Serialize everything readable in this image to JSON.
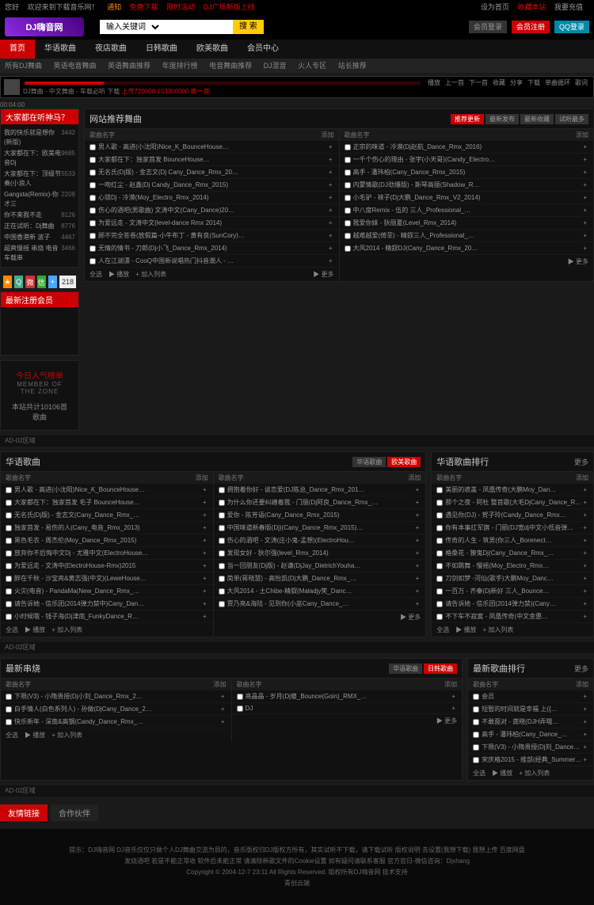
{
  "topbar": {
    "left": [
      "您好",
      "欢迎来到下载音乐网！",
      "通知",
      "免费下载",
      "限时活动",
      "DJ广场新版上线"
    ],
    "right": [
      "设为首页",
      "收藏本站",
      "我要充值"
    ]
  },
  "logo": "DJ嗨音网",
  "search": {
    "select": "输入关键词",
    "placeholder": "",
    "btn": "搜 索"
  },
  "header_btns": {
    "login": "会员登录",
    "reg": "会员注册",
    "qq": "QQ登录"
  },
  "nav": [
    "首页",
    "华语歌曲",
    "夜店歌曲",
    "日韩歌曲",
    "欧美歌曲",
    "会员中心"
  ],
  "subnav": [
    "所有DJ舞曲",
    "英语电音舞曲",
    "英语舞曲推荐",
    "年度排行榜",
    "电音舞曲推荐",
    "DJ混音",
    "火人专区",
    "站长推荐"
  ],
  "player": {
    "time": "00:04:00",
    "text": "DJ舞曲 - 中文舞曲 - 车载必听 下载",
    "text2": "上传720000 153300000 换一首",
    "btns": [
      "播放",
      "上一首",
      "下一首",
      "收藏",
      "分享",
      "下载",
      "单曲循环",
      "歌词"
    ]
  },
  "hot": {
    "title": "大家都在听神马？",
    "items": [
      {
        "n": "我的快乐就是想你(新版)",
        "c": "3442"
      },
      {
        "n": "大家都在下：欧美电音Dj",
        "c": "9685"
      },
      {
        "n": "大家都在下：顶级节奏(小浪人",
        "c": "5533"
      },
      {
        "n": "Gangsta(Remix)-你才三",
        "c": "2208"
      },
      {
        "n": "你不来我不走",
        "c": "8126"
      },
      {
        "n": "正在试听：Dj舞曲",
        "c": "8776"
      },
      {
        "n": "中国香港新 波子",
        "c": "4467"
      },
      {
        "n": "超爽慢摇 串烧 电音车载串",
        "c": "3466"
      }
    ]
  },
  "member_title": "最新注册会员",
  "share_count": "218",
  "zone": {
    "title": "今日人气榜单",
    "sub": "MEMBER OF THE ZONE",
    "text": "本站共计10106首歌曲"
  },
  "rec": {
    "title": "网站推荐舞曲",
    "tabs": [
      "推荐更新",
      "最新发布",
      "最新收藏",
      "试听最多"
    ],
    "head1": "歌曲名字",
    "head2": "添加",
    "left": [
      "男人歌 - 高进(小沈阳)Nice_K_BounceHouse…",
      "大家都在下：独家首发 BounceHouse…",
      "无名氏(Dj版) - 金志文(Dj Cany_Dance_Rmx_20…",
      "一吻红尘 - 赵鑫(Dj Candy_Dance_Rmx_2015)",
      "心锁Dj - 冷漠(Moy_Electro_Rmx_2014)",
      "伤心的酒吧(男歌曲) 文涛中文(Cany_Dance)20…",
      "为爱远走 - 文涛中文(level-dance Rmx 2014)",
      "顾不完全答卷(放假篇-小牛布丁 - 黄有良(SunCory)…",
      "无情的情书 - 刀郎(Dj小飞_Dance_Rmx_2014)",
      "人在江湖漂 - CooQ中国新说唱热门抖音潮人 - …"
    ],
    "right": [
      "正宗的味道 - 冷漠(Dj赵航_Dance_Rmx_2016)",
      "一千个伤心的理由 - 张宇(小天哥)(Candy_Electro…",
      "高手 - 潘玮柏(Cany_Dance_Rmx_2015)",
      "内蒙情歌(DJ劲爆版) - 斯琴高丽(Shadow_R…",
      "小毛驴 - 袜子(Dj大鹏_Dance_Rmx_V2_2014)",
      "中八度Remix - 伍的 三人_Professional_…",
      "我爱你妹 - 狄丽夏(Level_Rmx_2014)",
      "越难越爱(倚菲) - 精釵三人_Professional_…",
      "大风2014 - 精釵DJ(Cany_Dance_Rmx_20…",
      ""
    ]
  },
  "ad1": "AD-02区域",
  "hua": {
    "title": "华语歌曲",
    "tabs": [
      "华语歌曲",
      "欧美歌曲"
    ],
    "more": "更多",
    "left": [
      "男人歌 - 高进(小沈阳)Nice_K_BounceHouse…",
      "大家都在下：独家首发 毛子 BounceHouse…",
      "无名氏(Dj版) - 金志文(Cany_Dance_Rmx_…",
      "独家首发 - 易伤的人(Cany_电音_Rmx_2013)",
      "黑色毛衣 - 周杰伦(Moy_Dance_Rmx_2015)",
      "放弃你不后悔中文Dj - 尤雅中文(ElectroHouse…",
      "为爱远走 - 文涛中(ElectroHouse-Rmx)2015",
      "醉在千秋 - 沙宝亮&黄志强(中文)(LeweHouse…",
      "火灾(电音) - PandaMa(New_Dance_Rmx_…",
      "请告诉她 - 信乐团(2014弹力禁中)Cany_Dan…",
      "小时候哦 - 钱子海(Dj津南_FunkyDance_R…"
    ],
    "right": [
      "拥抱着你好 - 谈恋爱(DJ陈总_Dance_Rmx_201…",
      "为什么你还要纠缠着我 - 门丽(Dj阿良_Dance_Rmx_…",
      "爱你 - 陈芳语(Cany_Dance_Rmx_2015)",
      "中国味道新春版(Dj)(Cany_Dance_Rmx_2015)…",
      "伤心的酒吧 - 文涛(庄小鬼-孟想)(ElectroHou…",
      "发现女好 - 狄尔强(level_Rmx_2014)",
      "当一回朋友(Dj版) - 赵谦(DjJay_DietrichYouha…",
      "简单(蒋晓慧) - 高怡凯(Dj大鹏_Dance_Rmx_…",
      "大风2014 - 土Chibe-精釵(Maladjy笑_Danc…",
      "贾乃亮&海陆 - 见到你(小巫Cany_Dance_…"
    ]
  },
  "rank": {
    "title": "华语歌曲排行",
    "items": [
      "美丽的遮盖 - 凤凰传奇(大鹏Moy_Dan…",
      "那个之夜 - 阿杜 整首歌(大毛DjCany_Dance_R…",
      "遇见你(DJ) - 贺子玲(Candy_Dance_Rmx…",
      "你有本事扛军旗 - 门丽(DJ宽dj中文小低音弹…",
      "传奇的人生 - 筑男(你三人_Borenect…",
      "格桑花 - 獠鬼Dj(Cany_Dance_Rmx_…",
      "不如跳舞 - 慢摇(Moy_Electro_Rmx…",
      "刀剑如梦 -河仙(歌手)大鹏Moy_Danc…",
      "一百万 - 齐秦(Dj新好 三人_Bounce…",
      "请告诉她 - 信乐团(2014弹力禁)(Cany…",
      "不下车不寂寞 - 凤凰传奇(中文金惠…"
    ]
  },
  "ad2": "AD-02区域",
  "ye": {
    "title": "最新串烧",
    "tabs": [
      "华语歌曲",
      "日韩歌曲"
    ],
    "left": [
      "下限(V3) - 小隋贵授(Dj小刘_Dance_Rmx_2…",
      "白手情人(白色系列人) - 孙做(DjCany_Dance_2…",
      "快乐新年 - 深南&高钢(Candy_Dance_Rmx_…"
    ],
    "right": [
      "亮晶晶 - 岁月(Dj傻_Bounce(Goin)_RMX_…",
      "DJ"
    ]
  },
  "newrank": {
    "title": "最新歌曲排行",
    "items": [
      "会员",
      "短暂的时间就是幸福 上({…",
      "不敢面对 - 龚晓(DJH弄哦…",
      "高手 - 潘玮柏(Cany_Dance_…",
      "下限(V3) - 小隋贵授(Dj刘_Dance…",
      "宋庆格2015 - 维部(经典_Summer…"
    ]
  },
  "ad3": "AD-02区域",
  "ftabs": [
    "友情链接",
    "合作伙伴"
  ],
  "foot": {
    "l1": "提示：DJ嗨音网 DJ音乐仅仅只做个人DJ舞曲交流为目的，音乐版权归DJ版权方所有，其实试听不下载，请下载试听 版权说明 去设置(我想下载) 我想上传 百度网盘",
    "l2": "发烧酒吧 若是不能正常收 软件后未能正常 请清除新歌文件的Cookie设置 如有疑问请联系客服 官方官日-微信咨询：Djshang",
    "l3": "Copyright © 2004-12-7 23:11 All Rights Reserved. 版权所有DJ嗨音网 技术支持",
    "l4": "青创云端"
  },
  "foot_actions": {
    "all": "全选",
    "play": "▶ 播放",
    "add": "+ 加入列表",
    "more": "▶ 更多"
  }
}
